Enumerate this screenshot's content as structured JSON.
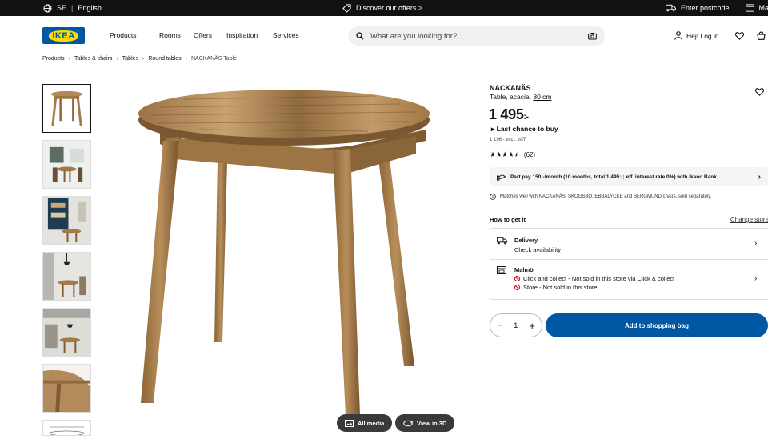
{
  "topbar": {
    "country": "SE",
    "language": "English",
    "offers": "Discover our offers >",
    "postcode": "Enter postcode",
    "store": "Malmö"
  },
  "header": {
    "logo_text": "IKEA",
    "nav": [
      "Products",
      "Rooms",
      "Offers",
      "Inspiration",
      "Services"
    ],
    "search_placeholder": "What are you looking for?",
    "login": "Hej! Log in"
  },
  "breadcrumb": [
    "Products",
    "Tables & chairs",
    "Tables",
    "Round tables",
    "NACKANÄS Table"
  ],
  "media": {
    "all_media": "All media",
    "view_3d": "View in 3D"
  },
  "product": {
    "name": "NACKANÄS",
    "desc": "Table, acacia, ",
    "size": "80 cm",
    "price": "1 495",
    "price_suffix": ":-",
    "last_chance": "Last chance to buy",
    "ex_vat": "1 196:- excl. VAT",
    "rating_value": 4.5,
    "reviews": "(62)",
    "part_pay": "Part pay 150:-/month (10 months, total 1 495:-; eff. interest rate 0%) with Ikano Bank",
    "match": "Matches well with NACKANÄS, SKOGSBO, EBBALYCKE and BERGMUND chairs, sold separately."
  },
  "get_it": {
    "title": "How to get it",
    "change": "Change store",
    "delivery_title": "Delivery",
    "delivery_sub": "Check availability",
    "store_title": "Malmö",
    "store_line1": "Click and collect - Not sold in this store via Click & collect",
    "store_line2": "Store - Not sold in this store"
  },
  "cart": {
    "quantity": "1",
    "add_label": "Add to shopping bag"
  },
  "colors": {
    "brand_blue": "#0058a3",
    "brand_yellow": "#ffdb00",
    "unavailable_red": "#cc0008"
  }
}
